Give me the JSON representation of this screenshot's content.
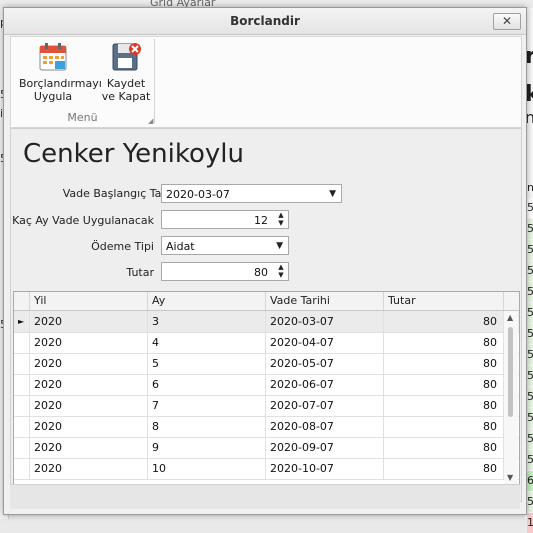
{
  "background": {
    "grid_title": "Grid Ayarlar",
    "left_fragments": [
      "pa",
      "5",
      "i",
      "5",
      "5"
    ],
    "right_big": [
      "r",
      "k",
      "ni"
    ],
    "right_header": "ni",
    "right_cells": [
      "5",
      "5",
      "5",
      "5",
      "5",
      "5",
      "5",
      "5",
      "5",
      "5",
      "5",
      "5",
      "5",
      "6",
      "5",
      "1"
    ],
    "right_cell_colors": [
      "#ffffff",
      "#e7f5e2",
      "#e7f5e2",
      "#e7f5e2",
      "#e7f5e2",
      "#e7f5e2",
      "#e7f5e2",
      "#e7f5e2",
      "#e7f5e2",
      "#e7f5e2",
      "#e7f5e2",
      "#e7f5e2",
      "#e7f5e2",
      "#c6efc0",
      "#e7f5e2",
      "#f7c9c9"
    ]
  },
  "window": {
    "title": "Borclandir",
    "close_label": "✕"
  },
  "ribbon": {
    "apply_button": "Borçlandırmayı Uygula",
    "save_close_button": "Kaydet ve Kapat",
    "group_label": "Menü"
  },
  "form": {
    "person_name": "Cenker Yenikoylu",
    "start_date_label": "Vade Başlangıç Tarihi",
    "start_date_value": "2020-03-07",
    "months_label": "Kaç Ay Vade Uygulanacak",
    "months_value": "12",
    "payment_type_label": "Ödeme Tipi",
    "payment_type_value": "Aidat",
    "amount_label": "Tutar",
    "amount_value": "80"
  },
  "grid": {
    "columns": [
      "Yil",
      "Ay",
      "Vade Tarihi",
      "Tutar"
    ],
    "rows": [
      {
        "yil": "2020",
        "ay": "3",
        "vade": "2020-03-07",
        "tutar": "80"
      },
      {
        "yil": "2020",
        "ay": "4",
        "vade": "2020-04-07",
        "tutar": "80"
      },
      {
        "yil": "2020",
        "ay": "5",
        "vade": "2020-05-07",
        "tutar": "80"
      },
      {
        "yil": "2020",
        "ay": "6",
        "vade": "2020-06-07",
        "tutar": "80"
      },
      {
        "yil": "2020",
        "ay": "7",
        "vade": "2020-07-07",
        "tutar": "80"
      },
      {
        "yil": "2020",
        "ay": "8",
        "vade": "2020-08-07",
        "tutar": "80"
      },
      {
        "yil": "2020",
        "ay": "9",
        "vade": "2020-09-07",
        "tutar": "80"
      },
      {
        "yil": "2020",
        "ay": "10",
        "vade": "2020-10-07",
        "tutar": "80"
      }
    ],
    "selected_row": 0
  }
}
